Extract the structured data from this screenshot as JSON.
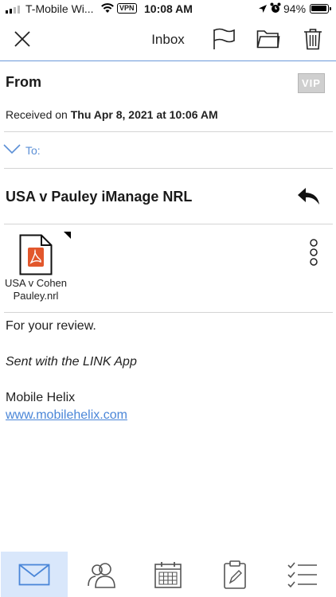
{
  "status_bar": {
    "carrier": "T-Mobile Wi...",
    "vpn": "VPN",
    "time": "10:08 AM",
    "battery": "94%",
    "battery_level": 0.94
  },
  "toolbar": {
    "title": "Inbox",
    "icons": [
      "close-icon",
      "flag-icon",
      "folder-icon",
      "trash-icon"
    ]
  },
  "message": {
    "from_label": "From",
    "vip_label": "VIP",
    "received_prefix": "Received on ",
    "received_date": "Thu Apr 8, 2021 at 10:06 AM",
    "to_label": "To:",
    "subject": "USA v Pauley iManage NRL",
    "attachment": {
      "name_line1": "USA v Cohen",
      "name_line2": "Pauley.nrl",
      "icon": "pdf-file-icon"
    },
    "body": {
      "line1": "For your review.",
      "signature_note": "Sent with the LINK App",
      "company": "Mobile Helix",
      "link": "www.mobilehelix.com"
    }
  },
  "tabbar": {
    "tabs": [
      "mail-icon",
      "contacts-icon",
      "calendar-icon",
      "notes-icon",
      "tasks-icon"
    ],
    "active_index": 0
  },
  "colors": {
    "accent": "#5b8fd6",
    "link": "#4a86d8",
    "active_tab_bg": "#d9e7fb",
    "pdf_red": "#e2572c"
  }
}
